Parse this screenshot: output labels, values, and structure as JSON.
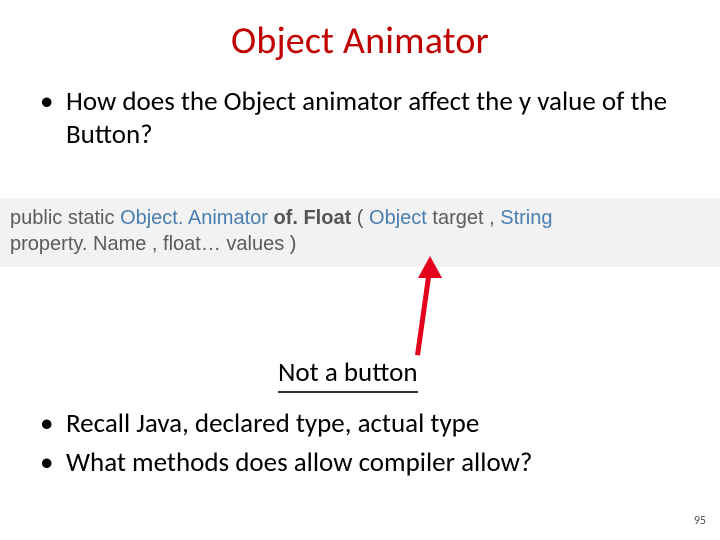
{
  "title": "Object Animator",
  "bullets_top": [
    "How does the Object animator affect the y value of the Button?"
  ],
  "code": {
    "kw1": "public static",
    "ret": "Object. Animator",
    "fn": "of. Float",
    "paren_open": "(",
    "p1_type": "Object",
    "p1_name": "target",
    "comma1": ", ",
    "p2_type": "String",
    "p2_name": "property. Name",
    "comma2": ", ",
    "p3": "float… values",
    "paren_close": ")"
  },
  "annotation": "Not a button",
  "bullets_bottom": [
    "Recall Java, declared type, actual type",
    "What methods does allow compiler allow?"
  ],
  "page_number": "95",
  "colors": {
    "title_red": "#c00000",
    "arrow_red": "#e4001b",
    "code_bg": "#f2f2f2",
    "link_blue": "#4a7db0"
  }
}
